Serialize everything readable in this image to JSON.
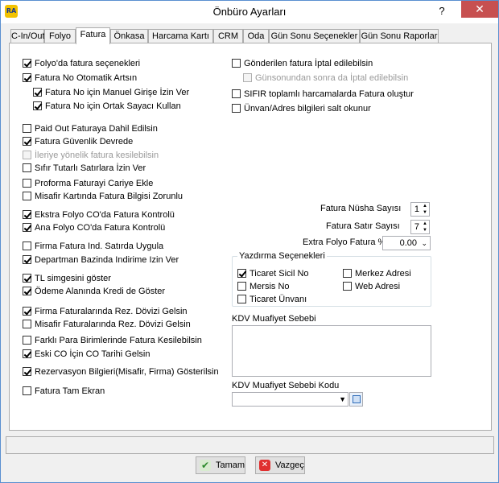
{
  "window": {
    "title": "Önbüro Ayarları",
    "help": "?",
    "close": "✕",
    "icon_text": "RA"
  },
  "tabs": [
    "C-In/Out",
    "Folyo",
    "Fatura",
    "Önkasa",
    "Harcama Kartı",
    "CRM",
    "Oda",
    "Gün Sonu Seçenekler",
    "Gün Sonu Raporlar"
  ],
  "active_tab": "Fatura",
  "left": {
    "c1": "Folyo'da fatura seçenekleri",
    "c2": "Fatura No Otomatik Artsın",
    "c3": "Fatura No için Manuel Girişe İzin Ver",
    "c4": "Fatura No için Ortak Sayacı Kullan",
    "c5": "Paid Out Faturaya Dahil Edilsin",
    "c6": "Fatura Güvenlik Devrede",
    "c7": "İleriye yönelik fatura kesilebilsin",
    "c8": "Sıfır Tutarlı Satırlara İzin Ver",
    "c9": "Proforma Faturayi Cariye Ekle",
    "c10": "Misafir Kartında Fatura Bilgisi Zorunlu",
    "c11": "Ekstra Folyo CO'da Fatura Kontrolü",
    "c12": "Ana Folyo CO'da Fatura Kontrolü",
    "c13": "Firma Fatura Ind. Satırda Uygula",
    "c14": "Departman Bazinda Indirime Izin Ver",
    "c15": "TL simgesini göster",
    "c16": "Ödeme Alanında Kredi de Göster",
    "c17": "Firma Faturalarında Rez. Dövizi Gelsin",
    "c18": "Misafir Faturalarında Rez. Dövizi Gelsin",
    "c19": "Farklı Para Birimlerinde Fatura Kesilebilsin",
    "c20": "Eski CO İçin CO Tarihi Gelsin",
    "c21": "Rezervasyon Bilgieri(Misafir, Firma) Gösterilsin",
    "c22": "Fatura Tam Ekran"
  },
  "right": {
    "r1": "Gönderilen fatura İptal edilebilsin",
    "r2": "Günsonundan sonra da İptal edilebilsin",
    "r3": "SIFIR toplamlı harcamalarda Fatura oluştur",
    "r4": "Ünvan/Adres bilgileri salt okunur",
    "nusha_label": "Fatura Nüsha Sayısı",
    "nusha_value": "1",
    "satir_label": "Fatura Satır Sayısı",
    "satir_value": "7",
    "extra_label": "Extra Folyo Fatura %",
    "extra_value": "0.00",
    "print_group_title": "Yazdırma Seçenekleri",
    "p1": "Ticaret Sicil No",
    "p2": "Mersis No",
    "p3": "Ticaret Ünvanı",
    "p4": "Merkez Adresi",
    "p5": "Web Adresi",
    "kdv_reason_label": "KDV Muafiyet Sebebi",
    "kdv_code_label": "KDV Muafiyet Sebebi Kodu"
  },
  "buttons": {
    "ok": "Tamam",
    "cancel": "Vazgeç"
  },
  "colors": {
    "accent": "#5a8fd0",
    "close": "#c75050"
  }
}
